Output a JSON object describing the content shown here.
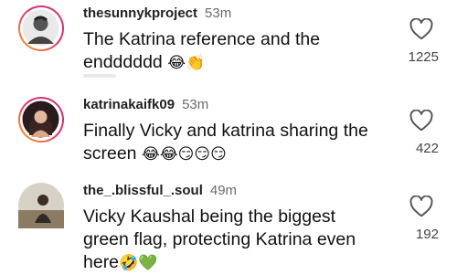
{
  "comments": [
    {
      "username": "thesunnykproject",
      "time": "53m",
      "text": "The Katrina reference and the endddddd",
      "emojis": "😂👏",
      "likes": "1225"
    },
    {
      "username": "katrinakaifk09",
      "time": "53m",
      "text": "Finally Vicky and katrina sharing the screen",
      "emojis": "😂😂😏😏😏",
      "likes": "422"
    },
    {
      "username": "the_.blissful_.soul",
      "time": "49m",
      "text": "Vicky Kaushal being the biggest green flag, protecting Katrina even here",
      "emojis": "🤣💚",
      "likes": "192"
    }
  ],
  "icons": {
    "like": "heart-outline-icon"
  },
  "colors": {
    "text": "#111111",
    "muted": "#6b6b6b",
    "story_ring_start": "#f9a825",
    "story_ring_end": "#c13584"
  }
}
